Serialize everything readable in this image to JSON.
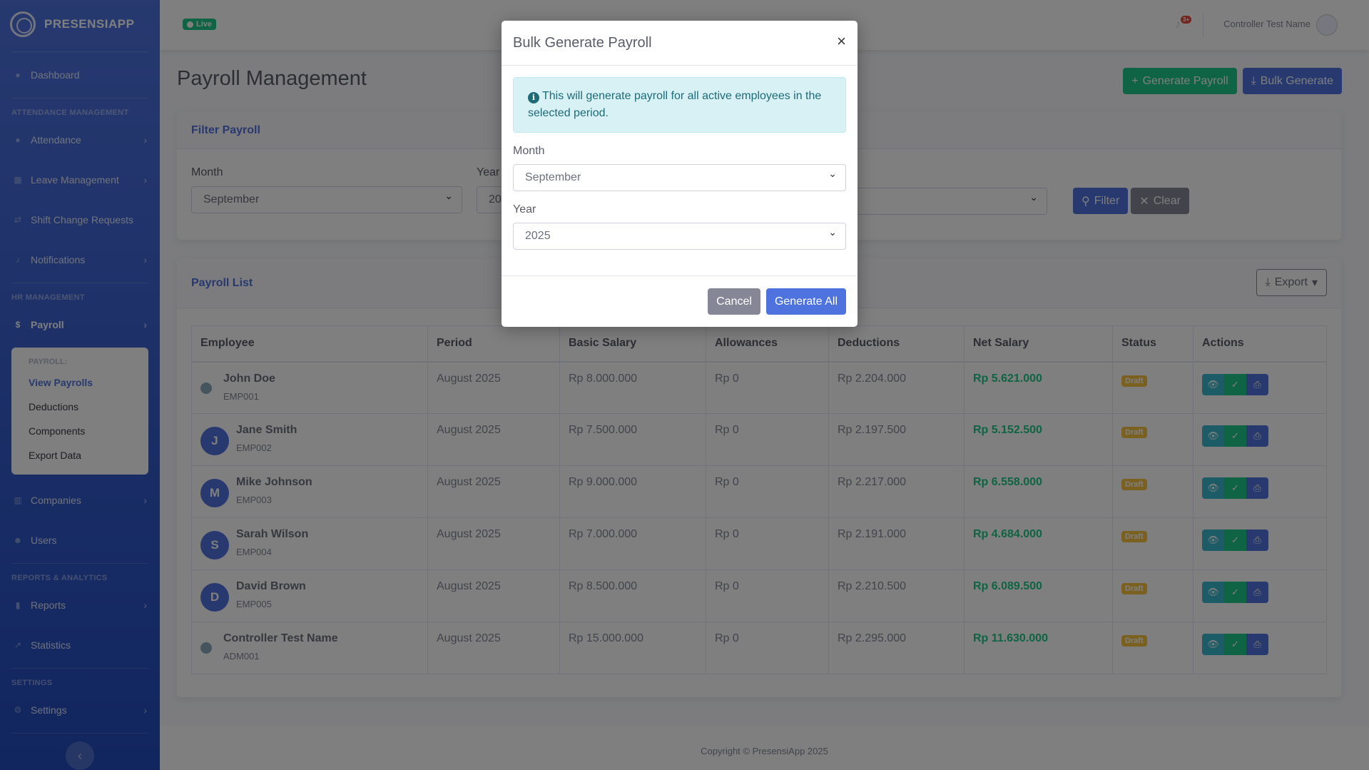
{
  "app": {
    "name": "PRESENSIAPP",
    "live_label": "Live"
  },
  "sidebar": {
    "dashboard": "Dashboard",
    "section_attendance": "ATTENDANCE MANAGEMENT",
    "attendance": "Attendance",
    "leave": "Leave Management",
    "shift": "Shift Change Requests",
    "notifications": "Notifications",
    "section_hr": "HR MANAGEMENT",
    "payroll": "Payroll",
    "payroll_sub": {
      "header": "PAYROLL:",
      "items": [
        "View Payrolls",
        "Deductions",
        "Components",
        "Export Data"
      ]
    },
    "companies": "Companies",
    "users": "Users",
    "section_reports": "REPORTS & ANALYTICS",
    "reports": "Reports",
    "statistics": "Statistics",
    "section_settings": "SETTINGS",
    "settings": "Settings"
  },
  "topbar": {
    "notif_count": "3+",
    "user_name": "Controller Test Name"
  },
  "page": {
    "title": "Payroll Management",
    "generate_btn": "Generate Payroll",
    "bulk_btn": "Bulk Generate"
  },
  "filter": {
    "title": "Filter Payroll",
    "month_label": "Month",
    "month_value": "September",
    "year_label": "Year",
    "year_value": "20",
    "filter_btn": "Filter",
    "clear_btn": "Clear"
  },
  "list": {
    "title": "Payroll List",
    "export_btn": "Export",
    "columns": [
      "Employee",
      "Period",
      "Basic Salary",
      "Allowances",
      "Deductions",
      "Net Salary",
      "Status",
      "Actions"
    ],
    "rows": [
      {
        "initial": "",
        "name": "John Doe",
        "code": "EMP001",
        "period": "August 2025",
        "basic": "Rp 8.000.000",
        "allow": "Rp 0",
        "deduct": "Rp 2.204.000",
        "net": "Rp 5.621.000",
        "status": "Draft"
      },
      {
        "initial": "J",
        "name": "Jane Smith",
        "code": "EMP002",
        "period": "August 2025",
        "basic": "Rp 7.500.000",
        "allow": "Rp 0",
        "deduct": "Rp 2.197.500",
        "net": "Rp 5.152.500",
        "status": "Draft"
      },
      {
        "initial": "M",
        "name": "Mike Johnson",
        "code": "EMP003",
        "period": "August 2025",
        "basic": "Rp 9.000.000",
        "allow": "Rp 0",
        "deduct": "Rp 2.217.000",
        "net": "Rp 6.558.000",
        "status": "Draft"
      },
      {
        "initial": "S",
        "name": "Sarah Wilson",
        "code": "EMP004",
        "period": "August 2025",
        "basic": "Rp 7.000.000",
        "allow": "Rp 0",
        "deduct": "Rp 2.191.000",
        "net": "Rp 4.684.000",
        "status": "Draft"
      },
      {
        "initial": "D",
        "name": "David Brown",
        "code": "EMP005",
        "period": "August 2025",
        "basic": "Rp 8.500.000",
        "allow": "Rp 0",
        "deduct": "Rp 2.210.500",
        "net": "Rp 6.089.500",
        "status": "Draft"
      },
      {
        "initial": "",
        "name": "Controller Test Name",
        "code": "ADM001",
        "period": "August 2025",
        "basic": "Rp 15.000.000",
        "allow": "Rp 0",
        "deduct": "Rp 2.295.000",
        "net": "Rp 11.630.000",
        "status": "Draft"
      }
    ]
  },
  "footer": {
    "copyright": "Copyright © PresensiApp 2025"
  },
  "modal": {
    "title": "Bulk Generate Payroll",
    "info": "This will generate payroll for all active employees in the selected period.",
    "month_label": "Month",
    "month_value": "September",
    "year_label": "Year",
    "year_value": "2025",
    "cancel_btn": "Cancel",
    "generate_btn": "Generate All"
  },
  "colors": {
    "primary": "#4e73df",
    "success": "#1cc88a",
    "info": "#36b9cc",
    "warning": "#f6c23e",
    "secondary": "#858796"
  }
}
